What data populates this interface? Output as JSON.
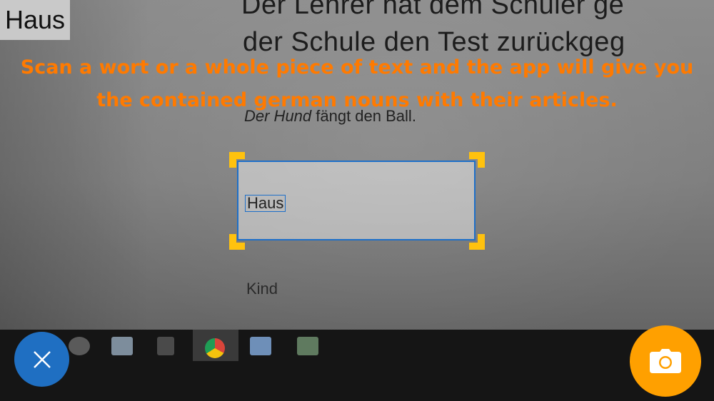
{
  "detected_word": "Haus",
  "hint": {
    "line1": "Scan a wort or a whole piece of text and the app will give you",
    "line2": "the contained german nouns with their articles."
  },
  "scan_frame": {
    "recognized_text": "Haus",
    "frame_color": "#1e6fc8",
    "corner_color": "#ffc20e"
  },
  "camera_view": {
    "line1": "Der Lehrer hat dem Schüler ge",
    "line2": "der Schule den Test zurückgeg",
    "sentence_italic": "Der Hund",
    "sentence_rest": " fängt den Ball.",
    "word_below": "Kind",
    "taskbar_icons": [
      "people-icon",
      "folder-icon",
      "store-icon",
      "chrome-icon",
      "app-icon",
      "notes-icon"
    ]
  },
  "buttons": {
    "close": {
      "icon": "close-icon",
      "color": "#1f6fc2"
    },
    "capture": {
      "icon": "camera-icon",
      "color": "#ffa000"
    }
  },
  "colors": {
    "hint": "#ff7a00"
  }
}
